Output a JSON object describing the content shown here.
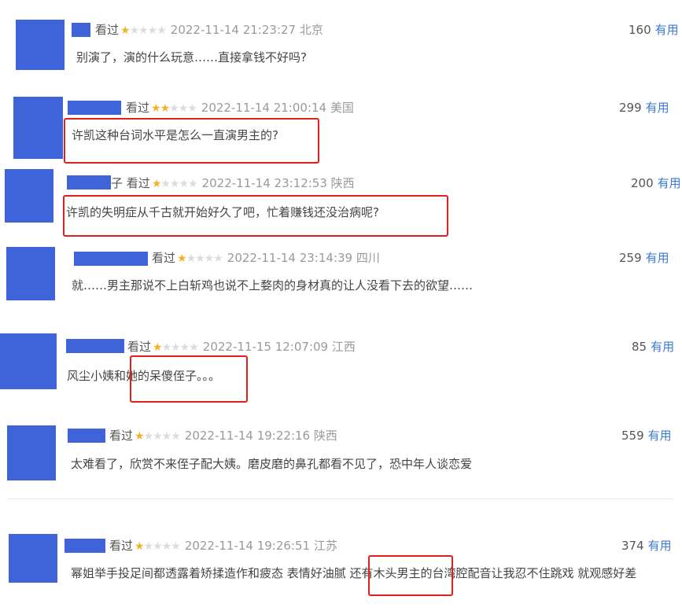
{
  "watched_label": "看过",
  "useful_label": "有用",
  "accent_colors": {
    "star": "#f2b12c",
    "useful_link": "#3a7bd5",
    "highlight_box": "#e01f1f",
    "redacted": "#3f63d9"
  },
  "comments": [
    {
      "name_suffix": "",
      "stars": 1,
      "rating_text": "★★★★★",
      "time": "2022-11-14 21:23:27",
      "location": "北京",
      "votes": "160",
      "text": "别演了，演的什么玩意……直接拿钱不好吗?"
    },
    {
      "name_suffix": "",
      "stars": 2,
      "rating_text": "★★★★★",
      "time": "2022-11-14 21:00:14",
      "location": "美国",
      "votes": "299",
      "text": "许凯这种台词水平是怎么一直演男主的?"
    },
    {
      "name_suffix": "子",
      "stars": 1,
      "rating_text": "★★★★★",
      "time": "2022-11-14 23:12:53",
      "location": "陕西",
      "votes": "200",
      "text": "许凯的失明症从千古就开始好久了吧，忙着赚钱还没治病呢?"
    },
    {
      "name_suffix": "",
      "stars": 1,
      "rating_text": "★★★★★",
      "time": "2022-11-14 23:14:39",
      "location": "四川",
      "votes": "259",
      "text": "就……男主那说不上白斩鸡也说不上婺肉的身材真的让人没看下去的欲望……"
    },
    {
      "name_suffix": "",
      "stars": 1,
      "rating_text": "★★★★★",
      "time": "2022-11-15 12:07:09",
      "location": "江西",
      "votes": "85",
      "text": "风尘小姨和她的呆傻侄子。。。"
    },
    {
      "name_suffix": "",
      "stars": 1,
      "rating_text": "★★★★★",
      "time": "2022-11-14 19:22:16",
      "location": "陕西",
      "votes": "559",
      "text": "太难看了，欣赏不来侄子配大姨。磨皮磨的鼻孔都看不见了，恐中年人谈恋爱"
    },
    {
      "name_suffix": "",
      "stars": 1,
      "rating_text": "★★★★★",
      "time": "2022-11-14 19:26:51",
      "location": "江苏",
      "votes": "374",
      "text": "幂姐举手投足间都透露着矫揉造作和疲态 表情好油腻 还有木头男主的台湾腔配音让我忍不住跳戏 就观感好差"
    }
  ]
}
